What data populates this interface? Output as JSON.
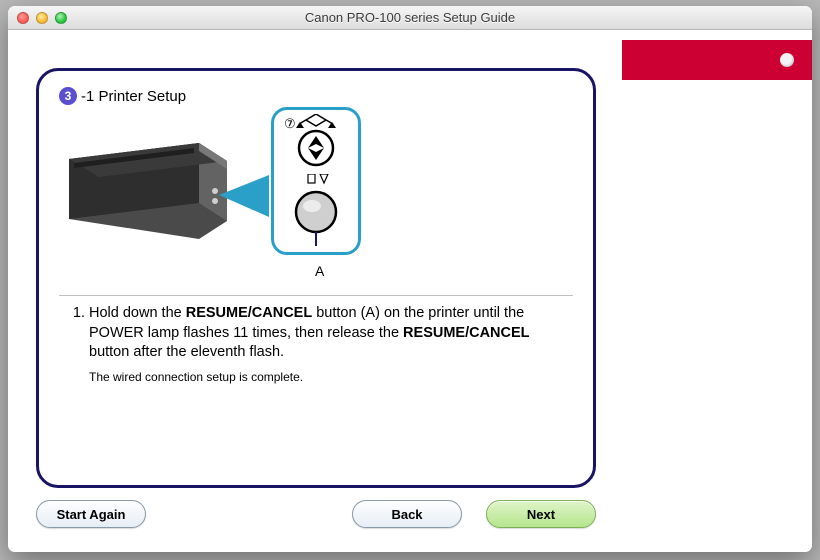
{
  "window": {
    "title": "Canon PRO-100 series Setup Guide"
  },
  "step": {
    "badge": "3",
    "suffix": "-1 Printer Setup",
    "detail_number": "⑦",
    "detail_label": "A"
  },
  "instruction": {
    "num": "1.",
    "seg1": "Hold down the ",
    "bold1": "RESUME/CANCEL",
    "seg2": " button (A) on the printer until the POWER lamp flashes 11 times, then release the ",
    "bold2": "RESUME/CANCEL",
    "seg3": " button after the eleventh flash.",
    "note": "The wired connection setup is complete."
  },
  "buttons": {
    "start_again": "Start Again",
    "back": "Back",
    "next": "Next"
  }
}
